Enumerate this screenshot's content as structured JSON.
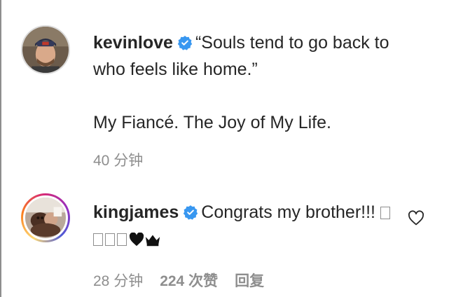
{
  "post_caption": {
    "username": "kevinlove",
    "text_line1": "“Souls tend to go back to who feels like home.”",
    "text_line2": "My Fiancé. The Joy of My Life.",
    "time": "40 分钟"
  },
  "comment": {
    "username": "kingjames",
    "text": "Congrats my brother!!!",
    "emoji_trail": "♥♛",
    "time": "28 分钟",
    "likes": "224 次赞",
    "reply_label": "回复"
  },
  "icons": {
    "verified": "verified-badge-icon",
    "like": "heart-outline-icon"
  },
  "colors": {
    "text": "#262626",
    "secondary": "#8e8e8e",
    "verified_blue": "#3897f0"
  }
}
